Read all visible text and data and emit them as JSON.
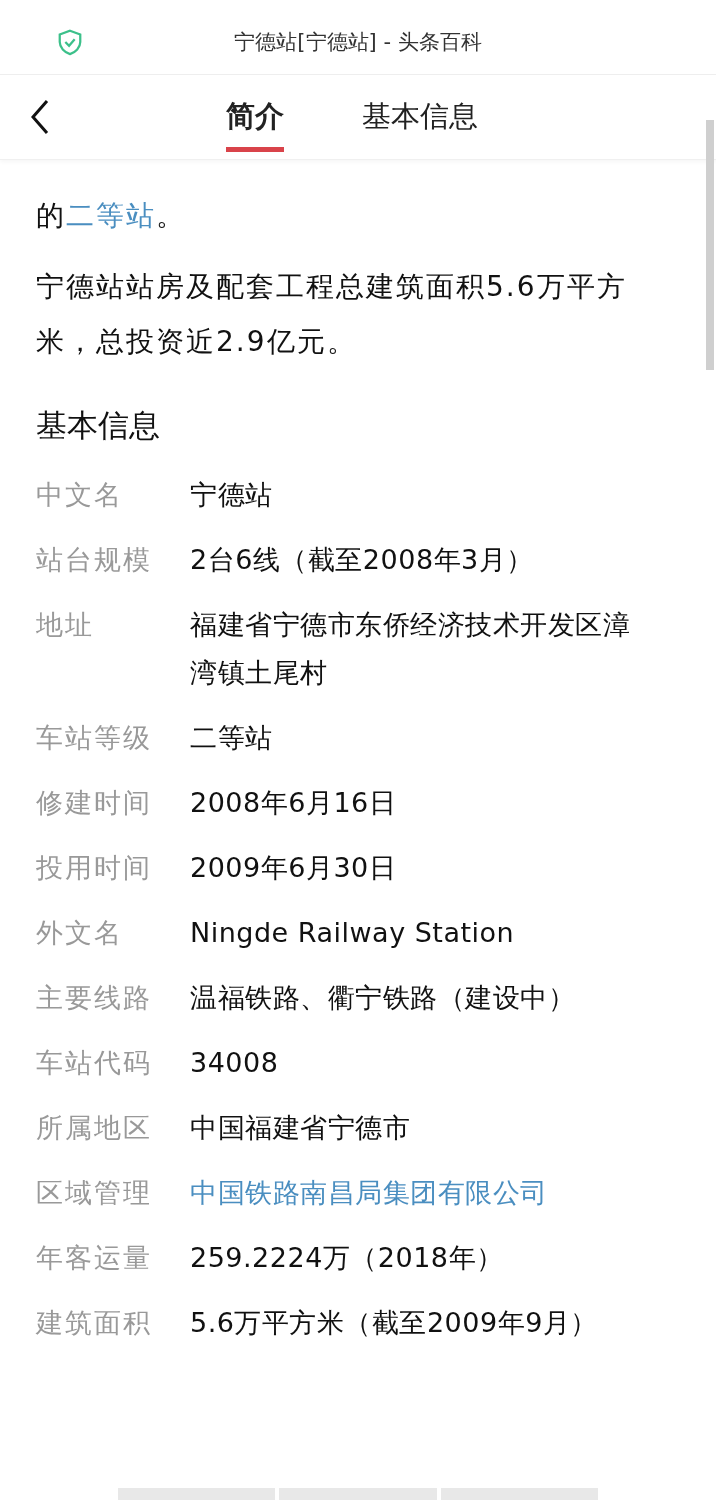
{
  "browser_bar": {
    "title": "宁德站[宁德站] - 头条百科"
  },
  "tabs": [
    {
      "label": "简介",
      "selected": true
    },
    {
      "label": "基本信息",
      "selected": false
    }
  ],
  "intro": [
    {
      "kind": "para",
      "parts": [
        {
          "text": "的"
        },
        {
          "text": "二等站",
          "link": true
        },
        {
          "text": "。"
        }
      ]
    },
    {
      "kind": "para",
      "parts": [
        {
          "text": "宁德站站房及配套工程总建筑面积5.6万平方米，总投资近2.9亿元。"
        }
      ]
    }
  ],
  "info_section": {
    "heading": "基本信息",
    "rows": [
      {
        "label": "中文名",
        "value": "宁德站",
        "link": false
      },
      {
        "label": "站台规模",
        "value": "2台6线（截至2008年3月）",
        "link": false
      },
      {
        "label": "地址",
        "value": "福建省宁德市东侨经济技术开发区漳湾镇土尾村",
        "link": false
      },
      {
        "label": "车站等级",
        "value": "二等站",
        "link": false
      },
      {
        "label": "修建时间",
        "value": "2008年6月16日",
        "link": false
      },
      {
        "label": "投用时间",
        "value": "2009年6月30日",
        "link": false
      },
      {
        "label": "外文名",
        "value": "Ningde Railway Station",
        "link": false
      },
      {
        "label": "主要线路",
        "value": "温福铁路、衢宁铁路（建设中）",
        "link": false
      },
      {
        "label": "车站代码",
        "value": "34008",
        "link": false
      },
      {
        "label": "所属地区",
        "value": "中国福建省宁德市",
        "link": false
      },
      {
        "label": "区域管理",
        "value": "中国铁路南昌局集团有限公司",
        "link": true
      },
      {
        "label": "年客运量",
        "value": "259.2224万（2018年）",
        "link": false
      },
      {
        "label": "建筑面积",
        "value": "5.6万平方米（截至2009年9月）",
        "link": false
      }
    ]
  }
}
